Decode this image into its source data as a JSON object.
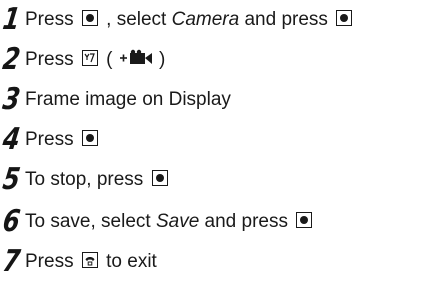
{
  "steps": [
    {
      "num": "1",
      "parts": [
        "Press ",
        " , select ",
        "Camera",
        " and press "
      ]
    },
    {
      "num": "2",
      "parts": [
        "Press ",
        " ( ",
        " )"
      ]
    },
    {
      "num": "3",
      "parts": [
        "Frame image on Display"
      ]
    },
    {
      "num": "4",
      "parts": [
        "Press "
      ]
    },
    {
      "num": "5",
      "parts": [
        "To stop, press "
      ]
    },
    {
      "num": "6",
      "parts": [
        "To save, select ",
        "Save",
        " and press "
      ]
    },
    {
      "num": "7",
      "parts": [
        "Press ",
        " to exit"
      ]
    }
  ],
  "icons": {
    "center_key": "center-key-icon",
    "video_key": "video-key-icon",
    "video_record": "video-record-icon",
    "end_key": "end-call-key-icon"
  }
}
